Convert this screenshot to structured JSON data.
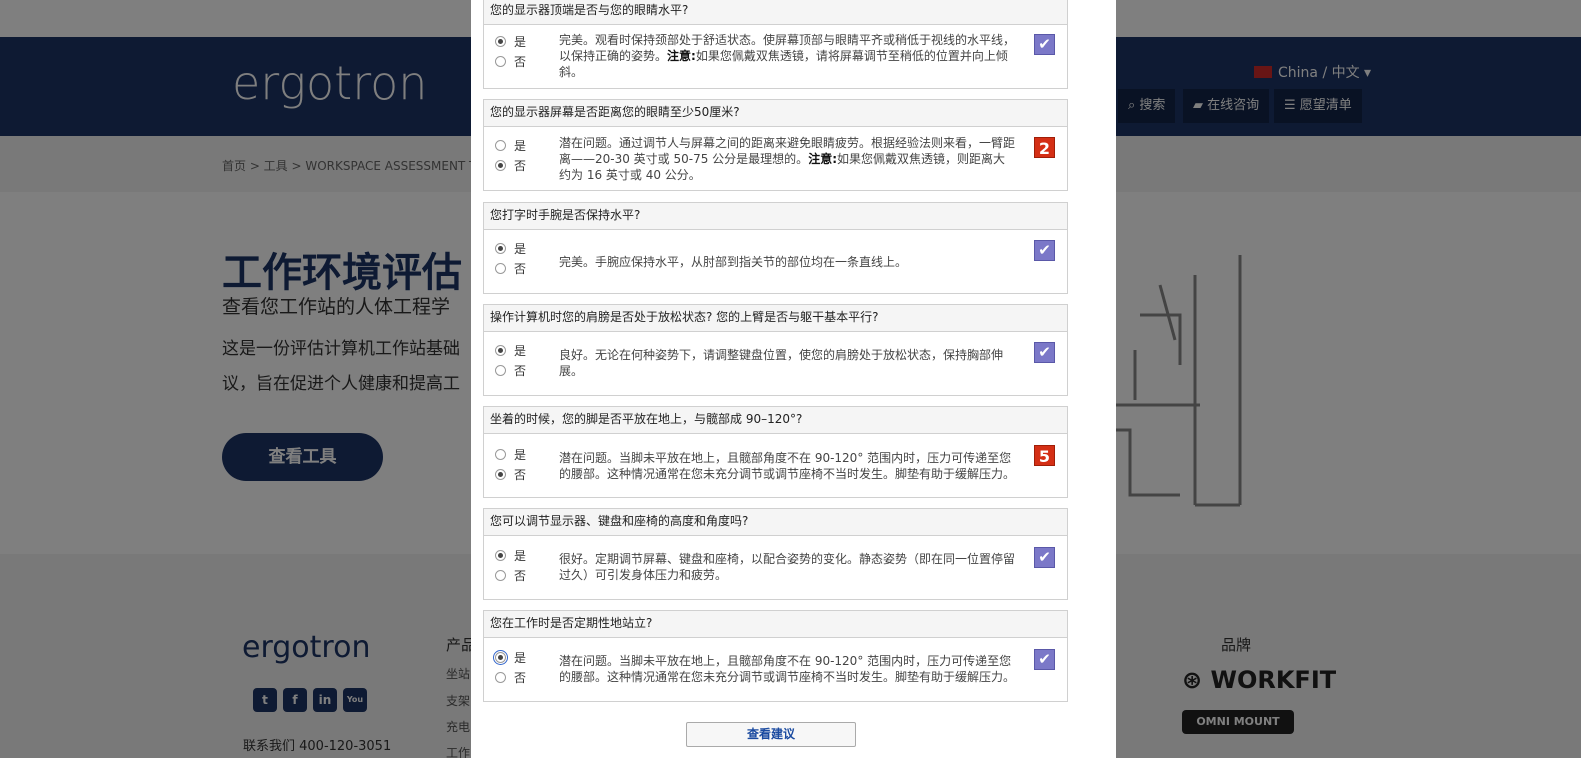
{
  "site": {
    "logo": "ergotron",
    "lang": "China / 中文 ▾",
    "nav_buttons": [
      "搜索",
      "在线咨询",
      "愿望清单"
    ],
    "breadcrumb": "首页  >  工具  >  WORKSPACE ASSESSMENT T",
    "hero_title": "工作环境评估",
    "hero_subtitle": "查看您工作站的人体工程学",
    "hero_text_1": "这是一份评估计算机工作站基础",
    "hero_text_2": "议，旨在促进个人健康和提高工",
    "hero_button": "查看工具",
    "footer_logo": "ergotron",
    "social": [
      "t",
      "f",
      "in",
      "You"
    ],
    "contact": "联系我们 400-120-3051",
    "footer_col_title": "产品",
    "footer_col_items": [
      "坐站",
      "支架",
      "充电",
      "工作"
    ],
    "brand_title": "品牌",
    "brand_workfit": "WORKFIT",
    "brand_omni": "OMNI MOUNT"
  },
  "yes_label": "是",
  "no_label": "否",
  "questions": [
    {
      "title": "您的显示器顶端是否与您的眼睛水平?",
      "answer": "yes",
      "feedback_pre": "完美。观看时保持颈部处于舒适状态。使屏幕顶部与眼睛平齐或稍低于视线的水平线，以保持正确的姿势。",
      "feedback_bold": "注意:",
      "feedback_post": "如果您佩戴双焦透镜，请将屏幕调节至稍低的位置并向上倾斜。",
      "mark": "✔"
    },
    {
      "title": "您的显示器屏幕是否距离您的眼睛至少50厘米?",
      "answer": "no",
      "feedback_pre": "潜在问题。通过调节人与屏幕之间的距离来避免眼睛疲劳。根据经验法则来看，一臂距离——20-30 英寸或 50-75 公分是最理想的。",
      "feedback_bold": "注意:",
      "feedback_post": "如果您佩戴双焦透镜，则距离大约为 16 英寸或 40 公分。",
      "mark": "2"
    },
    {
      "title": "您打字时手腕是否保持水平?",
      "answer": "yes",
      "feedback_pre": "完美。手腕应保持水平，从肘部到指关节的部位均在一条直线上。",
      "feedback_bold": "",
      "feedback_post": "",
      "mark": "✔"
    },
    {
      "title": "操作计算机时您的肩膀是否处于放松状态? 您的上臂是否与躯干基本平行?",
      "answer": "yes",
      "feedback_pre": "良好。无论在何种姿势下，请调整键盘位置，使您的肩膀处于放松状态，保持胸部伸展。",
      "feedback_bold": "",
      "feedback_post": "",
      "mark": "✔"
    },
    {
      "title": "坐着的时候，您的脚是否平放在地上，与髋部成 90–120°?",
      "answer": "no",
      "feedback_pre": "潜在问题。当脚未平放在地上，且髋部角度不在 90-120° 范围内时，压力可传递至您的腰部。这种情况通常在您未充分调节或调节座椅不当时发生。脚垫有助于缓解压力。",
      "feedback_bold": "",
      "feedback_post": "",
      "mark": "5"
    },
    {
      "title": "您可以调节显示器、键盘和座椅的高度和角度吗?",
      "answer": "yes",
      "feedback_pre": "很好。定期调节屏幕、键盘和座椅，以配合姿势的变化。静态姿势（即在同一位置停留过久）可引发身体压力和疲劳。",
      "feedback_bold": "",
      "feedback_post": "",
      "mark": "✔"
    },
    {
      "title": "您在工作时是否定期性地站立?",
      "answer": "yes",
      "feedback_pre": "潜在问题。当脚未平放在地上，且髋部角度不在 90-120° 范围内时，压力可传递至您的腰部。这种情况通常在您未充分调节或调节座椅不当时发生。脚垫有助于缓解压力。",
      "feedback_bold": "",
      "feedback_post": "",
      "mark": "✔"
    }
  ],
  "submit_label": "查看建议"
}
